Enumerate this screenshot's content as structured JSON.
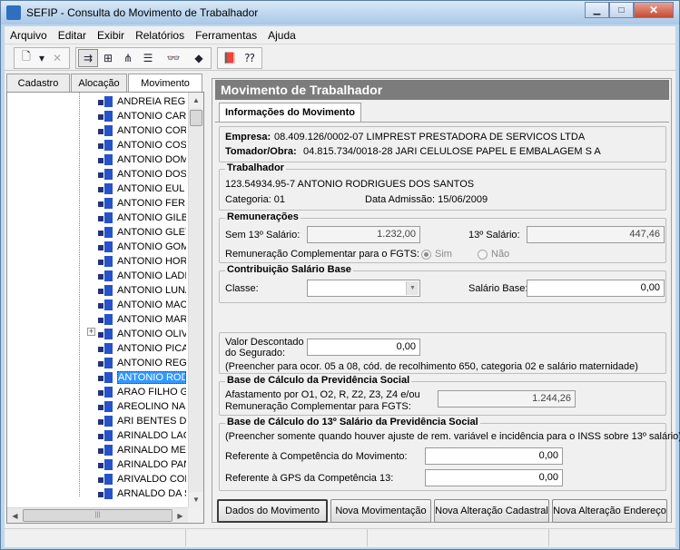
{
  "window": {
    "title": "SEFIP - Consulta do Movimento de Trabalhador"
  },
  "menu": [
    "Arquivo",
    "Editar",
    "Exibir",
    "Relatórios",
    "Ferramentas",
    "Ajuda"
  ],
  "left_tabs": [
    "Cadastro",
    "Alocação",
    "Movimento"
  ],
  "tree_items": [
    "ANDREIA REG",
    "ANTONIO CAR",
    "ANTONIO COR",
    "ANTONIO COS",
    "ANTONIO DOM",
    "ANTONIO DOS",
    "ANTONIO EUL",
    "ANTONIO FERI",
    "ANTONIO GILB",
    "ANTONIO GLEY",
    "ANTONIO GOM",
    "ANTONIO HOR",
    "ANTONIO LADI",
    "ANTONIO LUNA",
    "ANTONIO MAC",
    "ANTONIO MAR",
    "ANTONIO OLIV",
    "ANTONIO PICA",
    "ANTONIO REG",
    "ANTONIO ROD",
    "ARAO FILHO G",
    "AREOLINO NAS",
    "ARI BENTES D",
    "ARINALDO LAC",
    "ARINALDO ME",
    "ARINALDO PAN",
    "ARIVALDO COR",
    "ARNALDO DA S"
  ],
  "tree_selected_index": 19,
  "panel": {
    "header": "Movimento de Trabalhador",
    "tab": "Informações do Movimento",
    "empresa_label": "Empresa:",
    "empresa_value": "08.409.126/0002-07  LIMPREST PRESTADORA DE SERVICOS LTDA",
    "tomador_label": "Tomador/Obra:",
    "tomador_value": "04.815.734/0018-28  JARI CELULOSE PAPEL E EMBALAGEM S A",
    "trabalhador": {
      "title": "Trabalhador",
      "id_name": "123.54934.95-7 ANTONIO RODRIGUES DOS SANTOS",
      "categoria": "Categoria: 01",
      "admissao": "Data Admissão: 15/06/2009"
    },
    "remuneracoes": {
      "title": "Remunerações",
      "sem13_label": "Sem 13º Salário:",
      "sem13_value": "1.232,00",
      "sal13_label": "13º Salário:",
      "sal13_value": "447,46",
      "complementar_label": "Remuneração Complementar para o FGTS:",
      "sim": "Sim",
      "nao": "Não"
    },
    "contribuicao": {
      "title": "Contribuição Salário Base",
      "classe_label": "Classe:",
      "salario_base_label": "Salário Base:",
      "salario_base_value": "0,00"
    },
    "valor_descontado": {
      "label_line1": "Valor Descontado",
      "label_line2": "do Segurado:",
      "value": "0,00",
      "note": "(Preencher para ocor. 05 a 08, cód. de recolhimento 650, categoria 02 e salário maternidade)"
    },
    "base_previdencia": {
      "title": "Base de Cálculo da Previdência Social",
      "label_line1": "Afastamento por O1, O2, R, Z2, Z3, Z4 e/ou",
      "label_line2": "Remuneração Complementar para FGTS:",
      "value": "1.244,26"
    },
    "base_13": {
      "title": "Base de Cálculo do 13º Salário da Previdência Social",
      "note": "(Preencher somente quando houver ajuste de rem. variável e incidência para o INSS sobre 13º salário)",
      "ref_competencia_label": "Referente à Competência do Movimento:",
      "ref_competencia_value": "0,00",
      "ref_gps_label": "Referente à GPS da Competência 13:",
      "ref_gps_value": "0,00"
    }
  },
  "buttons": [
    "Dados do Movimento",
    "Nova Movimentação",
    "Nova Alteração Cadastral",
    "Nova Alteração Endereço"
  ]
}
